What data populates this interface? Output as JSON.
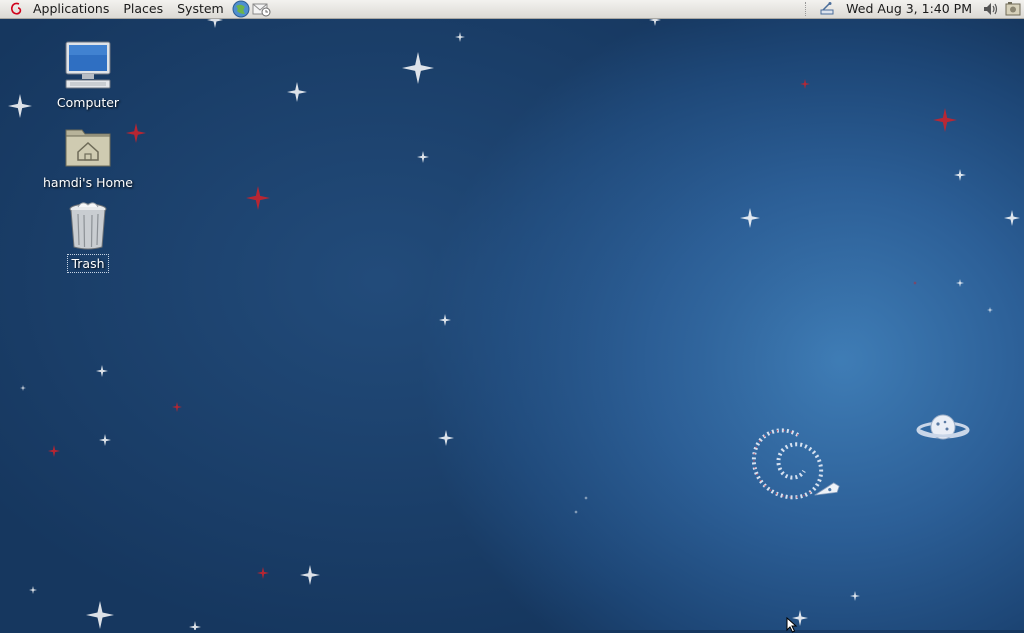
{
  "panel": {
    "menus": [
      "Applications",
      "Places",
      "System"
    ],
    "clock": "Wed Aug  3,  1:40 PM",
    "launchers": [
      "web-browser-icon",
      "mail-client-icon"
    ],
    "tray": [
      "network-icon",
      "volume-icon",
      "screenshot-icon"
    ]
  },
  "desktop": {
    "icons": [
      {
        "label": "Computer",
        "icon": "computer-icon"
      },
      {
        "label": "hamdi's Home",
        "icon": "home-folder-icon"
      },
      {
        "label": "Trash",
        "icon": "trash-icon"
      }
    ]
  },
  "colors": {
    "panel_bg": "#dcdad5",
    "desktop_blue": "#2c5f97",
    "star_red": "#c8232c",
    "star_white": "#ffffff"
  }
}
